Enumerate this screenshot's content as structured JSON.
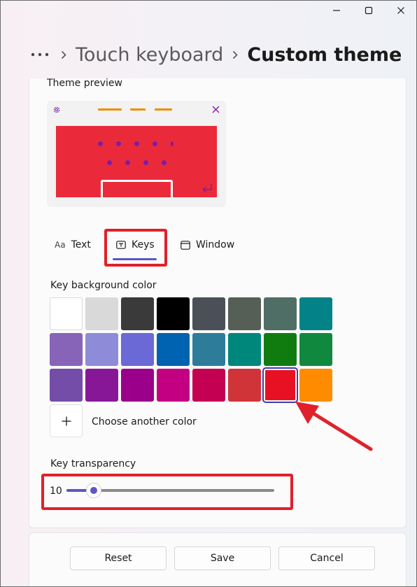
{
  "window": {
    "controls": [
      "minimize-icon",
      "maximize-icon",
      "close-icon"
    ]
  },
  "breadcrumb": {
    "more": "···",
    "previous": "Touch keyboard",
    "current": "Custom theme"
  },
  "preview": {
    "label": "Theme preview",
    "key_background": "#ea2a3b",
    "key_text": "#7a1ea6",
    "accent": "#f08c00"
  },
  "tabs": [
    {
      "label": "Text",
      "icon": "text-aa-icon",
      "selected": false
    },
    {
      "label": "Keys",
      "icon": "keys-icon",
      "selected": true
    },
    {
      "label": "Window",
      "icon": "window-icon",
      "selected": false
    }
  ],
  "key_background": {
    "label": "Key background color",
    "colors": [
      [
        "#ffffff",
        "#d9d9d9",
        "#3a3a3a",
        "#000000",
        "#4b5058",
        "#565f56",
        "#4f6e66",
        "#038387"
      ],
      [
        "#8764b8",
        "#8e8cd8",
        "#6b69d6",
        "#0063b1",
        "#2d7d9a",
        "#00877c",
        "#107c10",
        "#10893e"
      ],
      [
        "#744da9",
        "#881798",
        "#9a0089",
        "#c30082",
        "#c30052",
        "#d13438",
        "#e81123",
        "#ff8c00"
      ]
    ],
    "selected": "#e81123",
    "add_label": "Choose another color"
  },
  "transparency": {
    "label": "Key transparency",
    "value": "10",
    "fraction": 0.1
  },
  "buttons": {
    "reset": "Reset",
    "save": "Save",
    "cancel": "Cancel"
  },
  "annotation": {
    "color": "#e0212b"
  }
}
